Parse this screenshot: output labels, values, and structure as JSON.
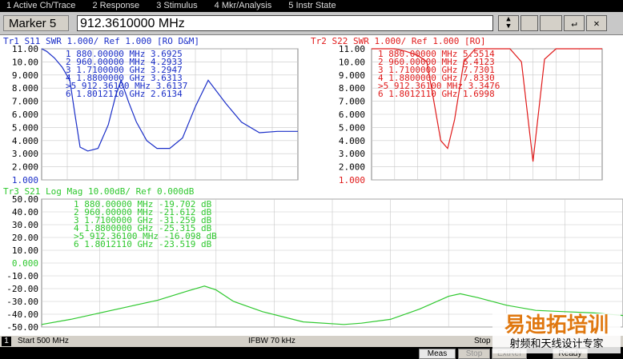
{
  "menu": [
    "1 Active Ch/Trace",
    "2 Response",
    "3 Stimulus",
    "4 Mkr/Analysis",
    "5 Instr State"
  ],
  "marker_bar": {
    "label": "Marker 5",
    "value": "912.3610000 MHz",
    "buttons": [
      "▲",
      "▼",
      "↵",
      "✕"
    ]
  },
  "colors": {
    "tr1": "#1a2ec8",
    "tr2": "#e01a1a",
    "tr3": "#2ec82e",
    "bg": "#ffffff",
    "grid": "#c8c8c8"
  },
  "chart_data": [
    {
      "type": "line",
      "title": "Tr1  S11  SWR 1.000/ Ref 1.000  [RO D&M]",
      "ylim": [
        1,
        11
      ],
      "y_ticks": [
        "11.00",
        "10.00",
        "9.000",
        "8.000",
        "7.000",
        "6.000",
        "5.000",
        "4.000",
        "3.000",
        "2.000",
        "1.000"
      ],
      "series": [
        {
          "name": "Tr1",
          "x": [
            0,
            0.02,
            0.05,
            0.08,
            0.11,
            0.13,
            0.15,
            0.18,
            0.22,
            0.26,
            0.29,
            0.31,
            0.34,
            0.37,
            0.41,
            0.45,
            0.5,
            0.55,
            0.6,
            0.65,
            0.72,
            0.78,
            0.85,
            0.92,
            1.0
          ],
          "y": [
            11,
            10.8,
            10.3,
            9.6,
            8.6,
            6,
            3.5,
            3.2,
            3.4,
            5.2,
            7.5,
            8.6,
            6.9,
            5.4,
            4,
            3.4,
            3.4,
            4.2,
            6.6,
            8.6,
            6.8,
            5.4,
            4.6,
            4.7,
            4.7
          ]
        }
      ],
      "markers": [
        {
          "n": "1",
          "f": "880.00000",
          "u": "MHz",
          "v": "3.6925"
        },
        {
          "n": "2",
          "f": "960.00000",
          "u": "MHz",
          "v": "4.2933"
        },
        {
          "n": "3",
          "f": "1.7100000",
          "u": "GHz",
          "v": "3.2947"
        },
        {
          "n": "4",
          "f": "1.8800000",
          "u": "GHz",
          "v": "3.6313"
        },
        {
          "n": ">5",
          "f": "912.36100",
          "u": "MHz",
          "v": "3.6137"
        },
        {
          "n": "6",
          "f": "1.8012110",
          "u": "GHz",
          "v": "2.6134"
        }
      ]
    },
    {
      "type": "line",
      "title": "Tr2  S22  SWR 1.000/ Ref 1.000  [RO]",
      "ylim": [
        1,
        11
      ],
      "y_ticks": [
        "11.00",
        "10.00",
        "9.000",
        "8.000",
        "7.000",
        "6.000",
        "5.000",
        "4.000",
        "3.000",
        "2.000",
        "1.000"
      ],
      "series": [
        {
          "name": "Tr2",
          "x": [
            0,
            0.05,
            0.1,
            0.15,
            0.2,
            0.24,
            0.27,
            0.3,
            0.33,
            0.36,
            0.4,
            0.45,
            0.5,
            0.55,
            0.6,
            0.65,
            0.7,
            0.75,
            0.8,
            0.85,
            0.9,
            0.95,
            1.0
          ],
          "y": [
            11,
            11,
            11,
            10.8,
            10.5,
            10,
            7,
            4,
            3.4,
            5.6,
            10,
            11,
            11,
            11,
            11,
            10,
            2.4,
            10.2,
            11,
            11,
            11,
            11,
            11
          ]
        }
      ],
      "markers": [
        {
          "n": "1",
          "f": "880.00000",
          "u": "MHz",
          "v": "5.5514"
        },
        {
          "n": "2",
          "f": "960.00000",
          "u": "MHz",
          "v": "6.4123"
        },
        {
          "n": "3",
          "f": "1.7100000",
          "u": "GHz",
          "v": "7.7301"
        },
        {
          "n": "4",
          "f": "1.8800000",
          "u": "GHz",
          "v": "7.8330"
        },
        {
          "n": ">5",
          "f": "912.36100",
          "u": "MHz",
          "v": "3.3476"
        },
        {
          "n": "6",
          "f": "1.8012110",
          "u": "GHz",
          "v": "1.6998"
        }
      ]
    },
    {
      "type": "line",
      "title": "Tr3  S21  Log Mag 10.00dB/ Ref 0.000dB",
      "ylim": [
        -50,
        50
      ],
      "y_ticks": [
        "50.00",
        "40.00",
        "30.00",
        "20.00",
        "10.00",
        "0.000",
        "-10.00",
        "-20.00",
        "-30.00",
        "-40.00",
        "-50.00"
      ],
      "series": [
        {
          "name": "Tr3",
          "x": [
            0,
            0.05,
            0.1,
            0.15,
            0.2,
            0.25,
            0.28,
            0.3,
            0.33,
            0.38,
            0.45,
            0.52,
            0.55,
            0.6,
            0.65,
            0.7,
            0.72,
            0.75,
            0.8,
            0.85,
            0.9,
            0.95,
            1.0
          ],
          "y": [
            -48,
            -44,
            -39,
            -34,
            -29,
            -22,
            -18,
            -21,
            -30,
            -38,
            -46,
            -48,
            -47,
            -44,
            -36,
            -26,
            -24,
            -27,
            -33,
            -37,
            -38,
            -39,
            -41
          ]
        }
      ],
      "markers": [
        {
          "n": "1",
          "f": "880.00000",
          "u": "MHz",
          "v": "-19.702",
          "d": "dB"
        },
        {
          "n": "2",
          "f": "960.00000",
          "u": "MHz",
          "v": "-21.612",
          "d": "dB"
        },
        {
          "n": "3",
          "f": "1.7100000",
          "u": "GHz",
          "v": "-31.259",
          "d": "dB"
        },
        {
          "n": "4",
          "f": "1.8800000",
          "u": "GHz",
          "v": "-25.315",
          "d": "dB"
        },
        {
          "n": ">5",
          "f": "912.36100",
          "u": "MHz",
          "v": "-16.098",
          "d": "dB"
        },
        {
          "n": "6",
          "f": "1.8012110",
          "u": "GHz",
          "v": "-23.519",
          "d": "dB"
        }
      ]
    }
  ],
  "bottom": {
    "ch": "1",
    "start": "Start 500 MHz",
    "ifbw": "IFBW 70 kHz",
    "stop": "Stop"
  },
  "status": [
    "Meas",
    "Stop",
    "ExtRef",
    "Ready"
  ],
  "watermark": {
    "line1": "易迪拓培训",
    "line2": "射频和天线设计专家"
  }
}
